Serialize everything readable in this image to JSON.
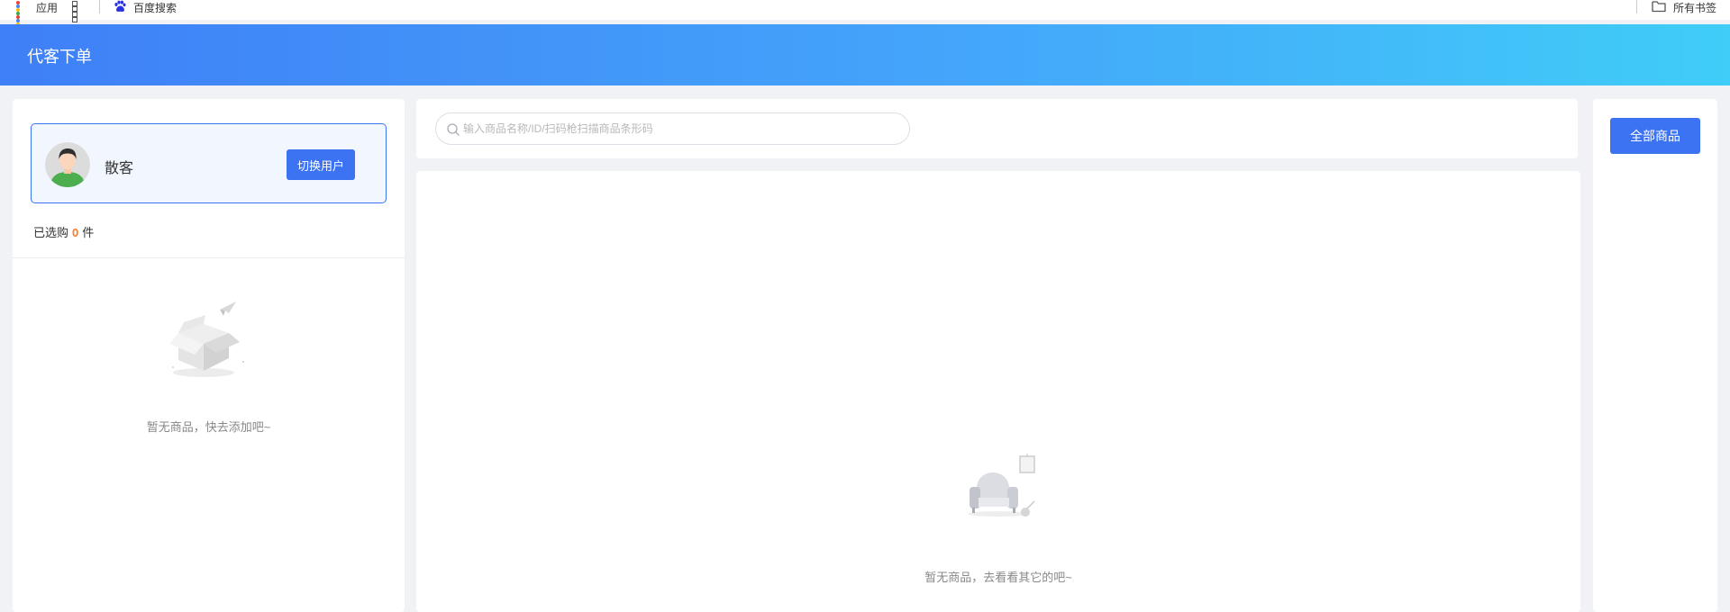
{
  "bookmarks_bar": {
    "apps_label": "应用",
    "baidu_label": "百度搜索",
    "all_bookmarks_label": "所有书签"
  },
  "header": {
    "title": "代客下单"
  },
  "customer": {
    "name": "散客",
    "switch_button": "切换用户"
  },
  "cart": {
    "selected_prefix": "已选购",
    "selected_count": "0",
    "selected_suffix": "件",
    "empty_text": "暂无商品，快去添加吧~"
  },
  "search": {
    "placeholder": "输入商品名称/ID/扫码枪扫描商品条形码",
    "value": ""
  },
  "products": {
    "empty_text": "暂无商品，去看看其它的吧~"
  },
  "categories": {
    "all_button": "全部商品"
  },
  "colors": {
    "primary": "#3c73f3",
    "header_gradient_start": "#3f7ff7",
    "header_gradient_end": "#40cdf8",
    "count_highlight": "#ff7a21"
  }
}
